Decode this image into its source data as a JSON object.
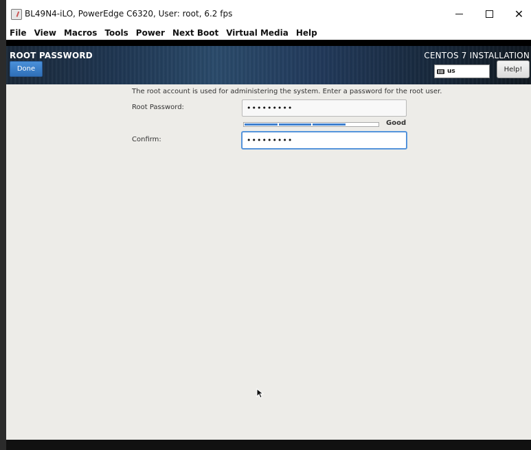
{
  "window": {
    "title": "BL49N4-iLO, PowerEdge C6320, User: root, 6.2 fps",
    "controls": {
      "minimize": "minimize-icon",
      "maximize": "maximize-icon",
      "close": "✕"
    }
  },
  "menubar": {
    "items": [
      "File",
      "View",
      "Macros",
      "Tools",
      "Power",
      "Next Boot",
      "Virtual Media",
      "Help"
    ]
  },
  "header": {
    "spoke_title": "ROOT PASSWORD",
    "done_label": "Done",
    "product_title": "CENTOS 7 INSTALLATION",
    "keyboard_layout": "us",
    "help_label": "Help!"
  },
  "form": {
    "description": "The root account is used for administering the system.  Enter a password for the root user.",
    "root_password_label": "Root Password:",
    "root_password_value": "•••••••••",
    "confirm_label": "Confirm:",
    "confirm_value": "•••••••••",
    "strength_text": "Good",
    "strength_level": 0.75,
    "strength_color": "#3d7fcf"
  },
  "colors": {
    "header_bg": "#1e3550",
    "done_button": "#2f6fb8",
    "content_bg": "#edece8"
  }
}
